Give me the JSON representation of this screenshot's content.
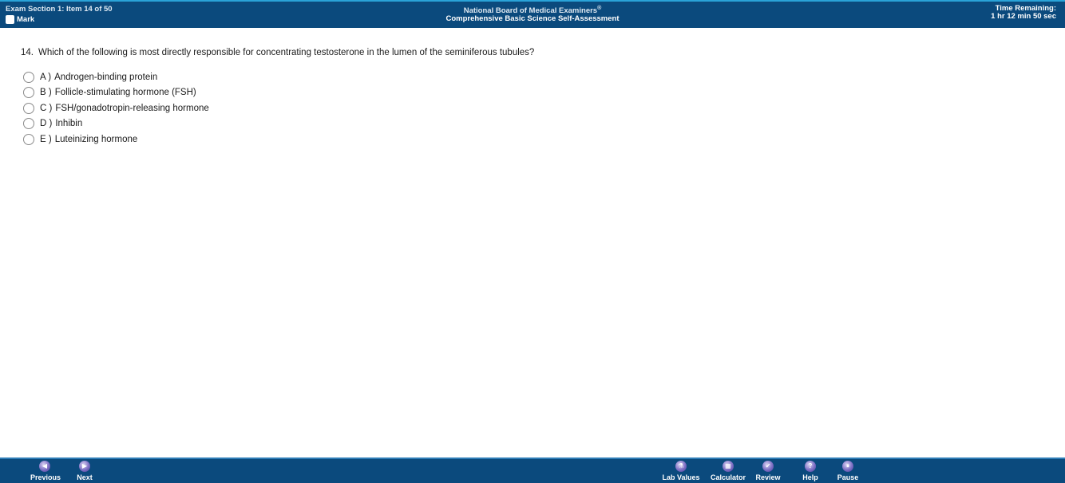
{
  "header": {
    "section": "Exam Section 1: Item 14 of 50",
    "mark_label": "Mark",
    "org": "National Board of Medical Examiners",
    "org_mark": "®",
    "exam_title": "Comprehensive Basic Science Self-Assessment",
    "time_label": "Time Remaining:",
    "time_value": "1 hr 12 min 50 sec"
  },
  "question": {
    "number": "14.",
    "text": "Which of the following is most directly responsible for concentrating testosterone in the lumen of the seminiferous tubules?",
    "options": [
      {
        "letter": "A )",
        "text": "Androgen-binding protein"
      },
      {
        "letter": "B )",
        "text": "Follicle-stimulating hormone (FSH)"
      },
      {
        "letter": "C )",
        "text": "FSH/gonadotropin-releasing hormone"
      },
      {
        "letter": "D )",
        "text": "Inhibin"
      },
      {
        "letter": "E )",
        "text": "Luteinizing hormone"
      }
    ]
  },
  "footer": {
    "previous": {
      "label": "Previous",
      "icon": "◀"
    },
    "next": {
      "label": "Next",
      "icon": "▶"
    },
    "lab_values": {
      "label": "Lab Values",
      "icon": "⚗"
    },
    "calculator": {
      "label": "Calculator",
      "icon": "▦"
    },
    "review": {
      "label": "Review",
      "icon": "✔"
    },
    "help": {
      "label": "Help",
      "icon": "?"
    },
    "pause": {
      "label": "Pause",
      "icon": "⏸"
    }
  }
}
